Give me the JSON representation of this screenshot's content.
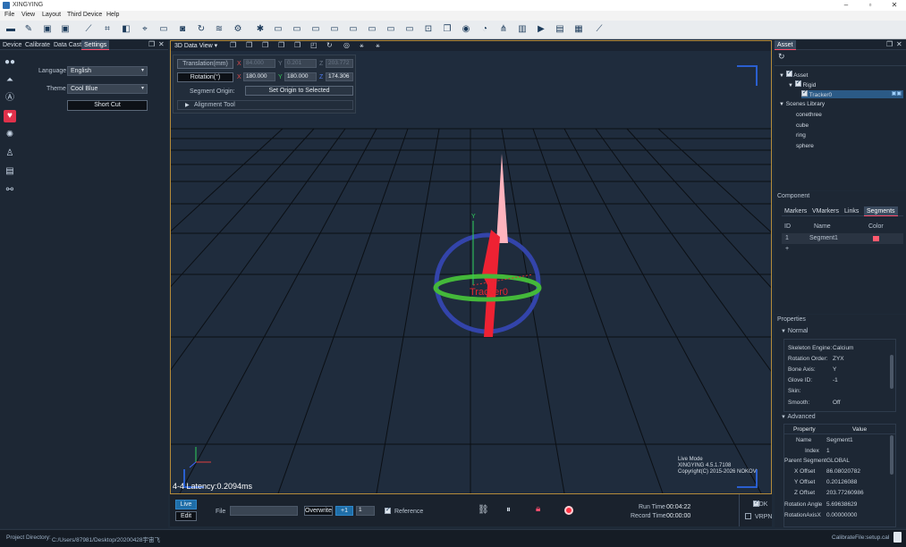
{
  "window": {
    "title": "XINGYING"
  },
  "menu": [
    "File",
    "View",
    "Layout",
    "Third Device",
    "Help"
  ],
  "toolbar_icons": [
    "folder-icon",
    "pencil-icon",
    "save-icon",
    "save-as-icon",
    "ruler-icon",
    "crop-icon",
    "frame-icon",
    "camera-icon",
    "refresh-icon",
    "layers-icon",
    "settings-icon",
    "monitor-1-icon",
    "monitor-2-icon",
    "monitor-3-icon",
    "monitor-4-icon",
    "monitor-5-icon",
    "monitor-6-icon",
    "monitor-7-icon",
    "monitor-8-icon",
    "monitor-9-icon",
    "lock-icon",
    "copy-icon",
    "sphere-icon",
    "gauge-icon",
    "network-icon",
    "bar-chart-icon",
    "video-icon",
    "chat-icon",
    "window-icon",
    "ruler-measure-icon"
  ],
  "left_panel": {
    "tabs": [
      "Device",
      "Calibrate",
      "Data Cast",
      "Settings"
    ],
    "active_tab": "Settings",
    "language_label": "Language",
    "language_value": "English",
    "theme_label": "Theme",
    "theme_value": "Cool Blue",
    "shortcut_button": "Short Cut"
  },
  "viewport": {
    "tab_label": "3D Data View",
    "translation_button": "Translation(mm)",
    "rotation_button": "Rotation(°)",
    "translation": {
      "x": "84.000",
      "y": "0.201",
      "z": "203.772"
    },
    "rotation": {
      "x": "180.000",
      "y": "180.000",
      "z": "174.306"
    },
    "axis_x": "X",
    "axis_y": "Y",
    "axis_z": "Z",
    "segment_origin_label": "Segment Origin:",
    "set_origin_button": "Set Origin to Selected",
    "alignment_tool": "Alignment Tool",
    "object_label": "Tracker0",
    "latency": "4-4 Latency:0.2094ms",
    "mode_text": "Live Mode",
    "version_text": "XINGYING 4.5.1.7108",
    "copyright_text": "Copyright(C) 2015-2026 NOKOV",
    "colors": {
      "ring_blue": "#3344aa",
      "ring_green": "#44b83a",
      "body_red": "#ee2233",
      "tip_pink": "#ffb3bd",
      "label_red": "#e5262f"
    }
  },
  "asset_panel": {
    "tab": "Asset",
    "tree": {
      "root": "Asset",
      "rigid": "Rigid",
      "tracker": "Tracker0",
      "scenes_library": "Scenes Library",
      "scenes": [
        "conethree",
        "cube",
        "ring",
        "sphere"
      ]
    }
  },
  "component_panel": {
    "title": "Component",
    "tabs": [
      "Markers",
      "VMarkers",
      "Links",
      "Segments"
    ],
    "active_tab": "Segments",
    "columns": [
      "ID",
      "Name",
      "Color"
    ],
    "rows": [
      {
        "id": "1",
        "name": "Segment1",
        "color": "#ff5a6e"
      }
    ],
    "add_row": "+"
  },
  "properties_panel": {
    "title": "Properties",
    "normal_section": "Normal",
    "normal": [
      {
        "label": "Skeleton Engine:",
        "value": "Calcium"
      },
      {
        "label": "Rotation Order:",
        "value": "ZYX"
      },
      {
        "label": "Bone Axis:",
        "value": "Y"
      },
      {
        "label": "Glove ID:",
        "value": "-1"
      },
      {
        "label": "Skin:",
        "value": ""
      },
      {
        "label": "Smooth:",
        "value": "Off"
      }
    ],
    "advanced_section": "Advanced",
    "advanced_columns": [
      "Property",
      "Value"
    ],
    "advanced": [
      {
        "label": "Name",
        "value": "Segment1"
      },
      {
        "label": "Index",
        "value": "1"
      },
      {
        "label": "Parent Segment",
        "value": "GLOBAL"
      },
      {
        "label": "X Offset",
        "value": "86.08020782"
      },
      {
        "label": "Y Offset",
        "value": "0.20126088"
      },
      {
        "label": "Z Offset",
        "value": "203.77260986"
      },
      {
        "label": "Rotation Angle",
        "value": "5.69638629"
      },
      {
        "label": "RotationAxisX",
        "value": "0.00000000"
      }
    ]
  },
  "bottom_bar": {
    "live_button": "Live",
    "edit_button": "Edit",
    "file_label": "File",
    "file_value": "",
    "overwrite_button": "Overwrite",
    "plus_button": "+1",
    "spin_value": "1",
    "reference_label": "Reference",
    "run_time_label": "Run Time",
    "run_time_value": "00:04:22",
    "record_time_label": "Record Time",
    "record_time_value": "00:00:00",
    "sdk_label": "SDK",
    "vrpn_label": "VRPN"
  },
  "status_bar": {
    "project_directory_label": "Project Directory:",
    "project_directory_value": "C:/Users/87981/Desktop/20200428宇宙飞",
    "calibrate_file": "CalibrateFile:setup.cal"
  }
}
